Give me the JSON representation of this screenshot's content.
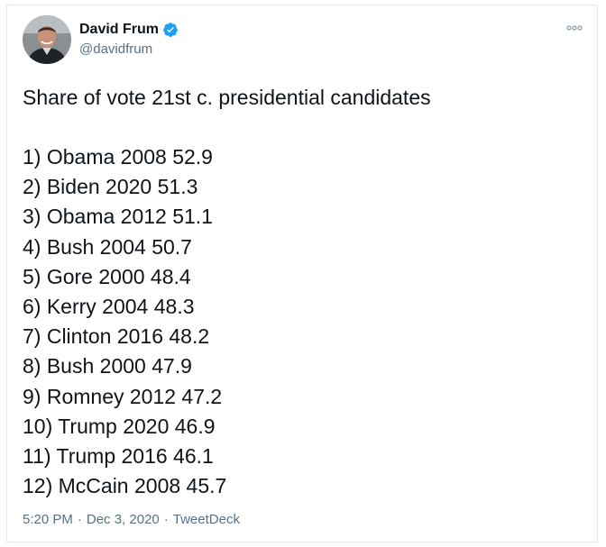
{
  "author": {
    "name": "David Frum",
    "handle": "@davidfrum",
    "verified": true
  },
  "tweet": {
    "title": "Share of vote 21st c. presidential candidates",
    "items": [
      "1) Obama 2008 52.9",
      "2) Biden 2020 51.3",
      "3) Obama 2012 51.1",
      "4) Bush 2004 50.7",
      "5) Gore 2000 48.4",
      "6) Kerry 2004 48.3",
      "7) Clinton 2016 48.2",
      "8) Bush 2000 47.9",
      "9) Romney 2012 47.2",
      "10) Trump 2020 46.9",
      "11) Trump 2016 46.1",
      "12) McCain 2008 45.7"
    ]
  },
  "meta": {
    "time": "5:20 PM",
    "separator": "·",
    "date": "Dec 3, 2020",
    "source": "TweetDeck"
  },
  "icons": {
    "verified": "verified-badge-icon",
    "more": "more-options-icon"
  },
  "colors": {
    "verified_blue": "#1da1f2",
    "text_primary": "#0f1419",
    "text_secondary": "#5b7083",
    "border": "#e1e8ed"
  }
}
